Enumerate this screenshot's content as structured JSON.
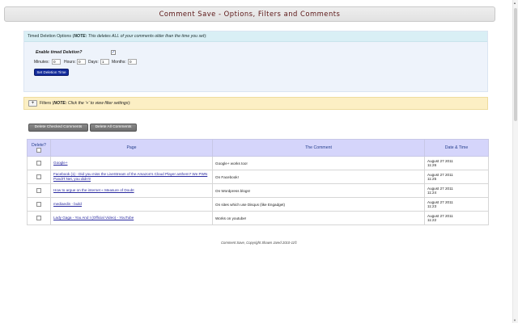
{
  "header": {
    "title": "Comment Save - Options, Filters and Comments"
  },
  "timed": {
    "title": "Timed Deletion Options",
    "note_label": "NOTE:",
    "note_text": "This deletes ALL of your comments older than the time you set",
    "enable_label": "Enable timed Deletion?",
    "enabled": true,
    "minutes_label": "Minutes:",
    "minutes_value": "0",
    "hours_label": "Hours:",
    "hours_value": "0",
    "days_label": "Days:",
    "days_value": "1",
    "months_label": "Months:",
    "months_value": "0",
    "set_button": "Set Deletion Time"
  },
  "filters": {
    "toggle": "+",
    "label": "Filters",
    "note_label": "NOTE:",
    "note_text": "Click the '+' to view filter settings"
  },
  "buttons": {
    "delete_checked": "Delete Checked Comments",
    "delete_all": "Delete All Comments"
  },
  "table": {
    "headers": {
      "delete": "Delete?",
      "page": "Page",
      "comment": "The Comment",
      "datetime": "Date & Time"
    },
    "rows": [
      {
        "page": "Google+",
        "comment": "Google+ works too!",
        "date": "August 27 2011",
        "time": "11:26"
      },
      {
        "page": "Facebook (1) - Did you miss the LiveStream of the Amazon's Cloud Player anthem? We PWN PandIT.Net, you didn't!",
        "comment": "On Facebook!",
        "date": "August 27 2011",
        "time": "11:25"
      },
      {
        "page": "How to argue on the internet « Measure of Doubt",
        "comment": "On Wordpress blogs!",
        "date": "August 27 2011",
        "time": "11:24"
      },
      {
        "page": "mediaedin - build",
        "comment": "On sites which use Disqus (like Engadget)",
        "date": "August 27 2011",
        "time": "11:23"
      },
      {
        "page": "Lady Gaga - You And I (Official Video) - YouTube",
        "comment": "Works on youtube!",
        "date": "August 27 2011",
        "time": "11:22"
      }
    ]
  },
  "footer": {
    "text": "Comment Save, Copyright Shawn Jared 2010-11©"
  }
}
